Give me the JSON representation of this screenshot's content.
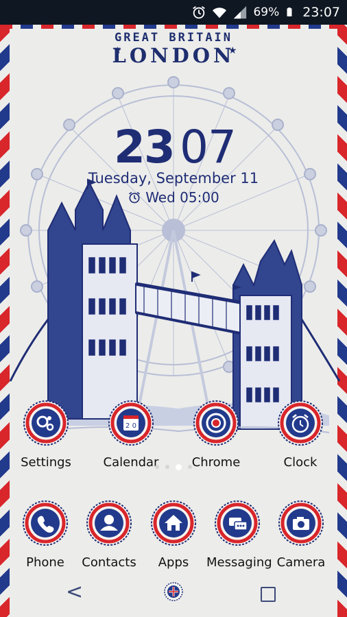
{
  "status_bar": {
    "battery": "69%",
    "time": "23:07",
    "icons": [
      "alarm-icon",
      "wifi-icon",
      "signal-icon",
      "battery-icon"
    ]
  },
  "wallpaper": {
    "title_top": "GREAT BRITAIN",
    "title_main": "LONDON"
  },
  "clock_widget": {
    "hours": "23",
    "minutes": "07",
    "date": "Tuesday, September 11",
    "alarm": "Wed 05:00"
  },
  "apps_row1": [
    {
      "label": "Settings",
      "icon": "gears-icon"
    },
    {
      "label": "Calendar",
      "icon": "calendar-icon"
    },
    {
      "label": "Chrome",
      "icon": "chrome-icon"
    },
    {
      "label": "Clock",
      "icon": "alarm-clock-icon"
    }
  ],
  "page_indicator": {
    "pages": 4,
    "active": 2
  },
  "dock": [
    {
      "label": "Phone",
      "icon": "phone-icon"
    },
    {
      "label": "Contacts",
      "icon": "contact-icon"
    },
    {
      "label": "Apps",
      "icon": "home-icon"
    },
    {
      "label": "Messaging",
      "icon": "chat-icon"
    },
    {
      "label": "Camera",
      "icon": "camera-icon"
    }
  ],
  "colors": {
    "navy": "#1f2d75",
    "red": "#d8262b",
    "paper": "#ececea"
  }
}
